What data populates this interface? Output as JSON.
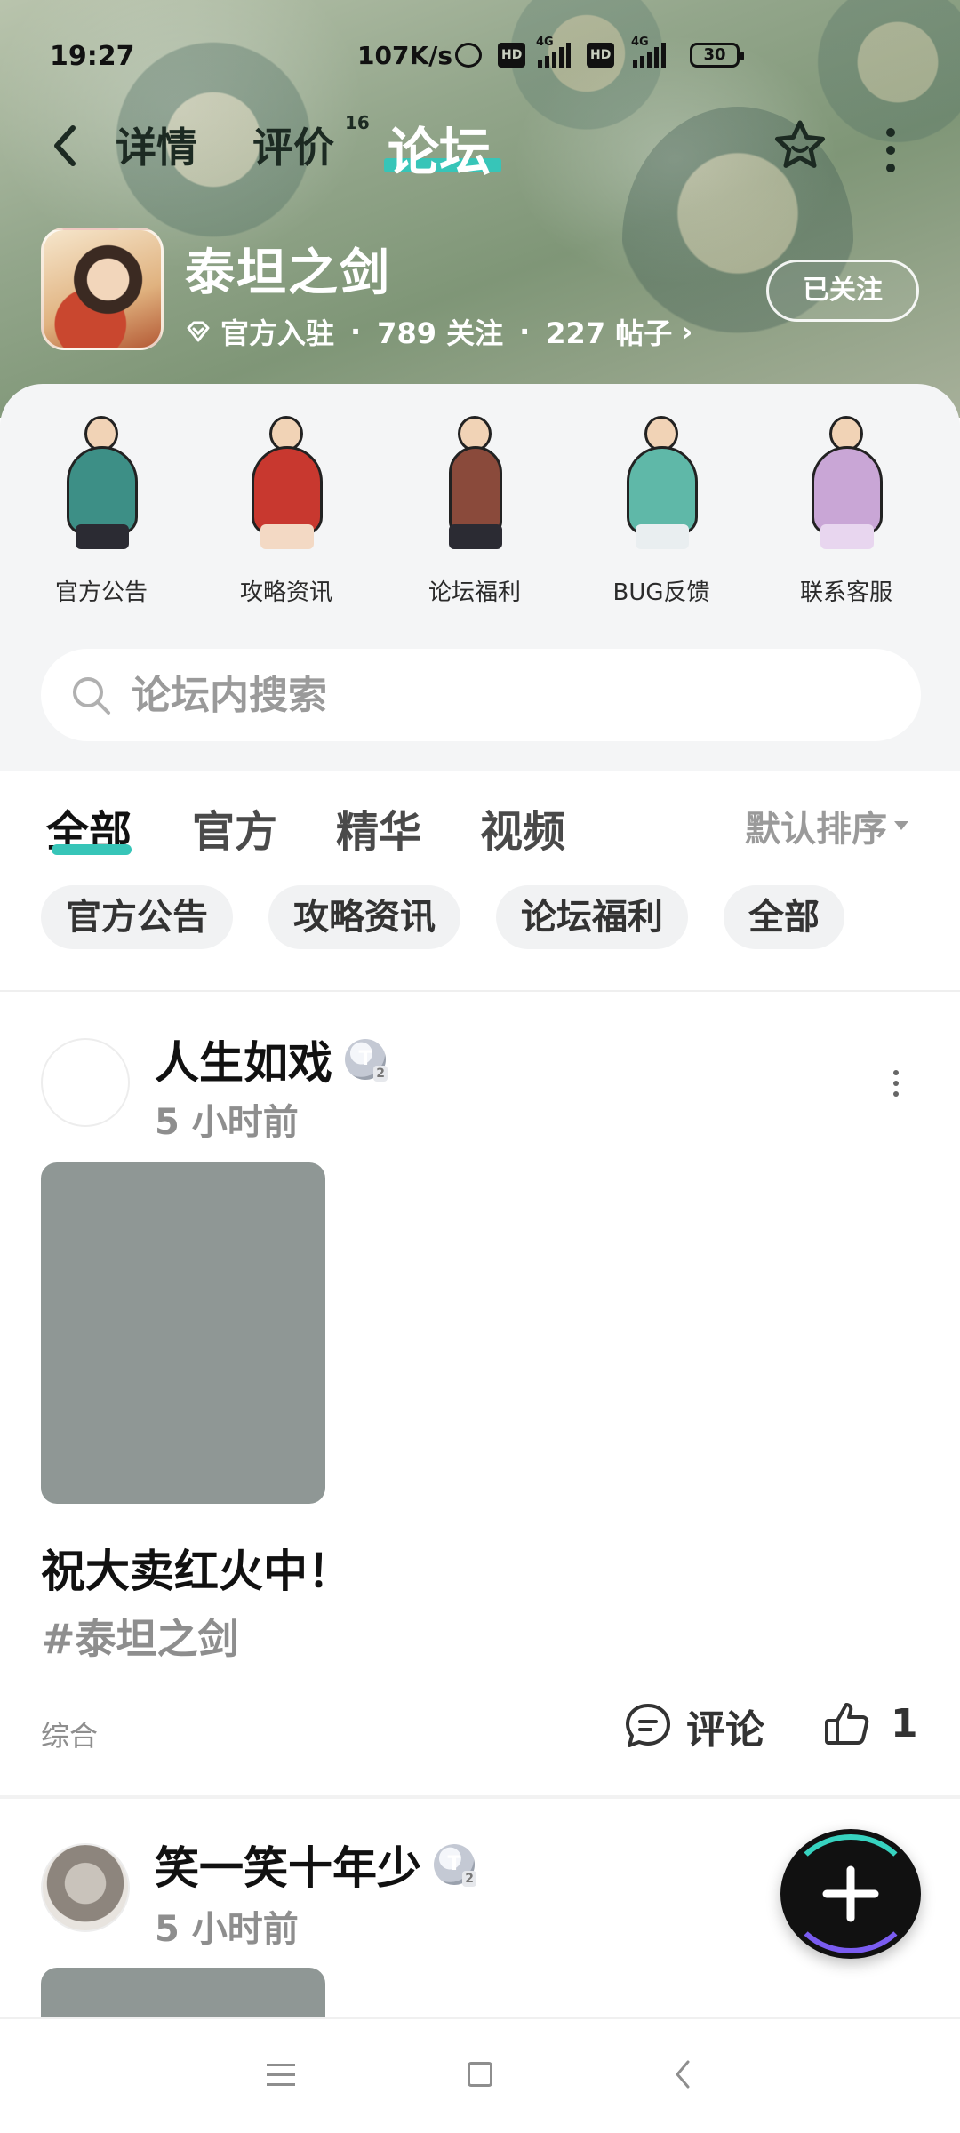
{
  "status_bar": {
    "time": "19:27",
    "network_speed": "107K/s",
    "hd": "HD",
    "network_type": "4G",
    "battery": "30"
  },
  "nav": {
    "tabs": [
      {
        "label": "详情"
      },
      {
        "label": "评价",
        "count": "16"
      },
      {
        "label": "论坛"
      }
    ],
    "active_tab": "论坛"
  },
  "game": {
    "title": "泰坦之剑",
    "official": "官方入驻",
    "followers": "789 关注",
    "posts": "227 帖子",
    "follow_button": "已关注"
  },
  "quick_entries": [
    {
      "label": "官方公告"
    },
    {
      "label": "攻略资讯"
    },
    {
      "label": "论坛福利"
    },
    {
      "label": "BUG反馈"
    },
    {
      "label": "联系客服"
    }
  ],
  "search": {
    "placeholder": "论坛内搜索"
  },
  "filters": {
    "tabs": [
      {
        "label": "全部"
      },
      {
        "label": "官方"
      },
      {
        "label": "精华"
      },
      {
        "label": "视频"
      }
    ],
    "active": "全部",
    "sort": "默认排序"
  },
  "chips": [
    {
      "label": "官方公告"
    },
    {
      "label": "攻略资讯"
    },
    {
      "label": "论坛福利"
    },
    {
      "label": "全部"
    }
  ],
  "posts": [
    {
      "username": "人生如戏",
      "level": "T",
      "level_num": "2",
      "time": "5 小时前",
      "title": "祝大卖红火中！",
      "topic": "#泰坦之剑",
      "category": "综合",
      "comment_label": "评论",
      "likes": "1"
    },
    {
      "username": "笑一笑十年少",
      "level": "T",
      "level_num": "2",
      "time": "5 小时前"
    }
  ],
  "colors": {
    "accent": "#37c5b8",
    "text_primary": "#111111",
    "text_secondary": "#8e8e8e"
  }
}
